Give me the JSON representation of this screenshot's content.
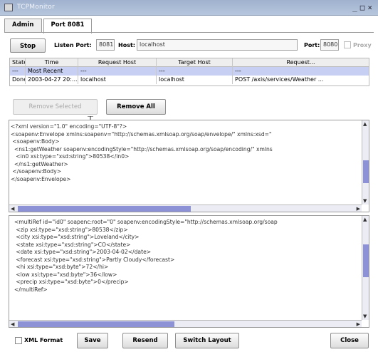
{
  "window": {
    "title": "TCPMonitor",
    "controls": [
      "_",
      "□",
      "×"
    ]
  },
  "tabs": [
    {
      "label": "Admin",
      "active": false
    },
    {
      "label": "Port 8081",
      "active": true
    }
  ],
  "listener": {
    "stop_label": "Stop",
    "listen_port_label": "Listen Port:",
    "listen_port": "8081",
    "host_label": "Host:",
    "host": "localhost",
    "port_label": "Port:",
    "port": "8080",
    "proxy_label": "Proxy",
    "proxy_checked": false
  },
  "table": {
    "headers": [
      "State",
      "Time",
      "Request Host",
      "Target Host",
      "Request..."
    ],
    "rows": [
      {
        "state": "---",
        "time": "Most Recent",
        "request_host": "---",
        "target_host": "---",
        "request": "---",
        "selected": true
      },
      {
        "state": "Done",
        "time": "2003-04-27 20:...",
        "request_host": "localhost",
        "target_host": "localhost",
        "request": "POST /axis/services/Weather ...",
        "selected": false
      }
    ]
  },
  "actions": {
    "remove_selected": "Remove Selected",
    "remove_all": "Remove All"
  },
  "request_pane": {
    "text": "<?xml version=\"1.0\" encoding=\"UTF-8\"?>\n<soapenv:Envelope xmlns:soapenv=\"http://schemas.xmlsoap.org/soap/envelope/\" xmlns:xsd=\"\n <soapenv:Body>\n  <ns1:getWeather soapenv:encodingStyle=\"http://schemas.xmlsoap.org/soap/encoding/\" xmlns\n   <in0 xsi:type=\"xsd:string\">80538</in0>\n  </ns1:getWeather>\n </soapenv:Body>\n</soapenv:Envelope>"
  },
  "response_pane": {
    "text": "  <multiRef id=\"id0\" soapenc:root=\"0\" soapenv:encodingStyle=\"http://schemas.xmlsoap.org/soap\n   <zip xsi:type=\"xsd:string\">80538</zip>\n   <city xsi:type=\"xsd:string\">Loveland</city>\n   <state xsi:type=\"xsd:string\">CO</state>\n   <date xsi:type=\"xsd:string\">2003-04-02</date>\n   <forecast xsi:type=\"xsd:string\">Partly Cloudy</forecast>\n   <hi xsi:type=\"xsd:byte\">72</hi>\n   <low xsi:type=\"xsd:byte\">36</low>\n   <precip xsi:type=\"xsd:byte\">0</precip>\n  </multiRef>"
  },
  "bottom": {
    "xml_format_label": "XML Format",
    "xml_format_checked": false,
    "save_label": "Save",
    "resend_label": "Resend",
    "switch_layout_label": "Switch Layout",
    "close_label": "Close"
  },
  "colors": {
    "titlebar": "#a9b9d4",
    "selection": "#c7d0f2",
    "scroll_thumb": "#8d91d6"
  }
}
